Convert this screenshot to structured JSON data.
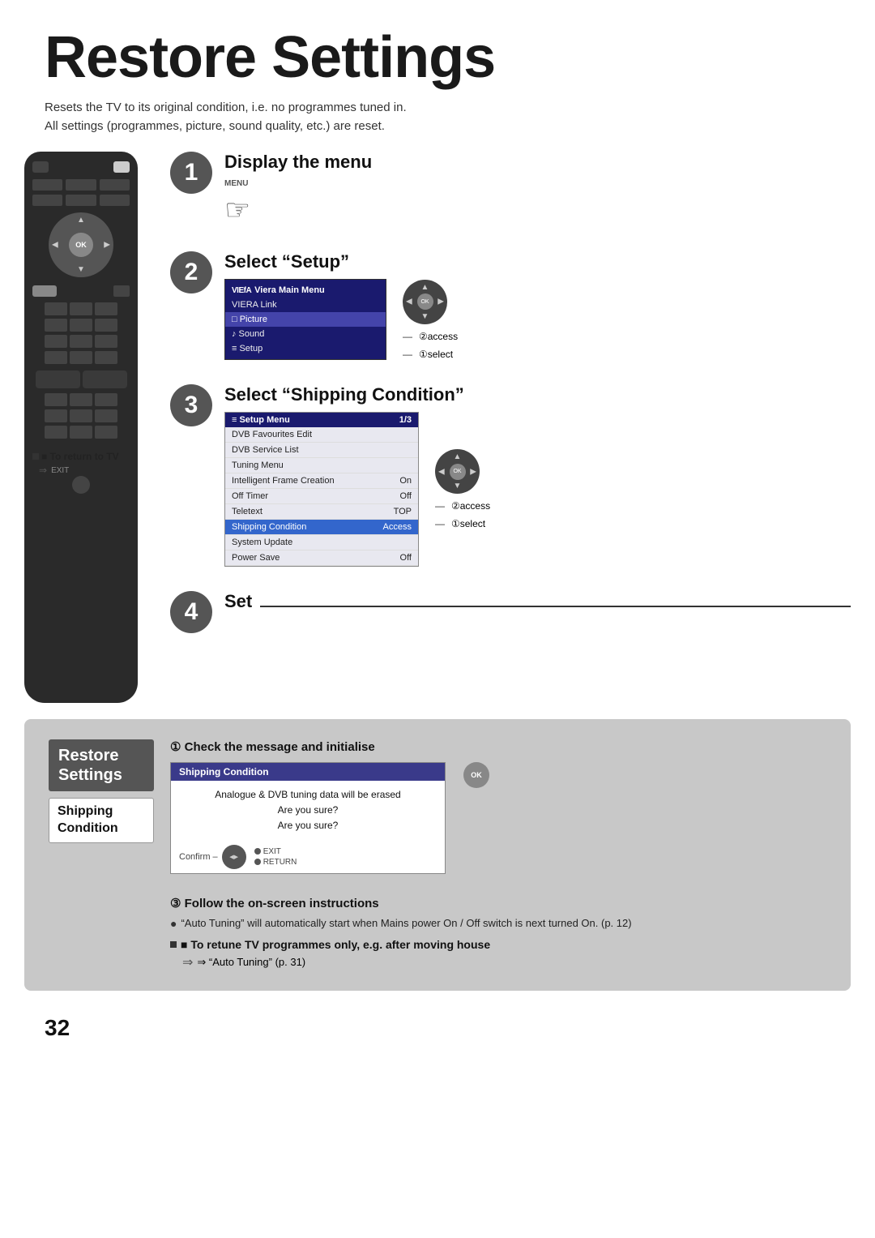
{
  "page": {
    "title": "Restore Settings",
    "subtitle_line1": "Resets the TV to its original condition, i.e. no programmes tuned in.",
    "subtitle_line2": "All settings (programmes, picture, sound quality, etc.) are reset.",
    "page_number": "32"
  },
  "steps": [
    {
      "number": "1",
      "title": "Display the menu",
      "sub_label": "MENU"
    },
    {
      "number": "2",
      "title": "Select “Setup”",
      "access_label": "②access",
      "select_label": "①select"
    },
    {
      "number": "3",
      "title": "Select “Shipping Condition”",
      "access_label": "②access",
      "select_label": "①select"
    },
    {
      "number": "4",
      "title": "Set"
    }
  ],
  "main_menu": {
    "header": "Viera Main Menu",
    "items": [
      {
        "label": "VIERA Link",
        "selected": false,
        "icon": ""
      },
      {
        "label": "□ Picture",
        "selected": true,
        "icon": ""
      },
      {
        "label": "♪ Sound",
        "selected": false,
        "icon": ""
      },
      {
        "label": "≡ Setup",
        "selected": false,
        "icon": ""
      }
    ]
  },
  "setup_menu": {
    "header": "≡ Setup Menu",
    "page": "1/3",
    "items": [
      {
        "label": "DVB Favourites Edit",
        "value": "",
        "selected": false
      },
      {
        "label": "DVB Service List",
        "value": "",
        "selected": false
      },
      {
        "label": "Tuning Menu",
        "value": "",
        "selected": false
      },
      {
        "label": "Intelligent Frame Creation",
        "value": "On",
        "selected": false
      },
      {
        "label": "Off Timer",
        "value": "Off",
        "selected": false
      },
      {
        "label": "Teletext",
        "value": "TOP",
        "selected": false
      },
      {
        "label": "Shipping Condition",
        "value": "Access",
        "selected": true
      },
      {
        "label": "System Update",
        "value": "",
        "selected": false
      },
      {
        "label": "Power Save",
        "value": "Off",
        "selected": false
      }
    ]
  },
  "bottom_section": {
    "restore_label": "Restore\nSettings",
    "shipping_label": "Shipping\nCondition",
    "check_title": "① Check the message and initialise",
    "dialog": {
      "header": "Shipping Condition",
      "body_line1": "Analogue & DVB tuning data will be erased",
      "body_line2": "Are you sure?",
      "body_line3": "Are you sure?",
      "confirm_label": "Confirm –",
      "exit_label": "EXIT",
      "return_label": "RETURN"
    },
    "follow_title": "③ Follow the on-screen instructions",
    "follow_bullets": [
      "“Auto Tuning” will automatically start when Mains power On / Off switch is next turned On. (p. 12)"
    ],
    "retune_title": "■ To retune TV programmes only, e.g. after moving house",
    "retune_arrow": "⇒ “Auto Tuning” (p. 31)"
  },
  "remote": {
    "to_return_label": "■ To return to TV",
    "exit_label": "EXIT"
  }
}
